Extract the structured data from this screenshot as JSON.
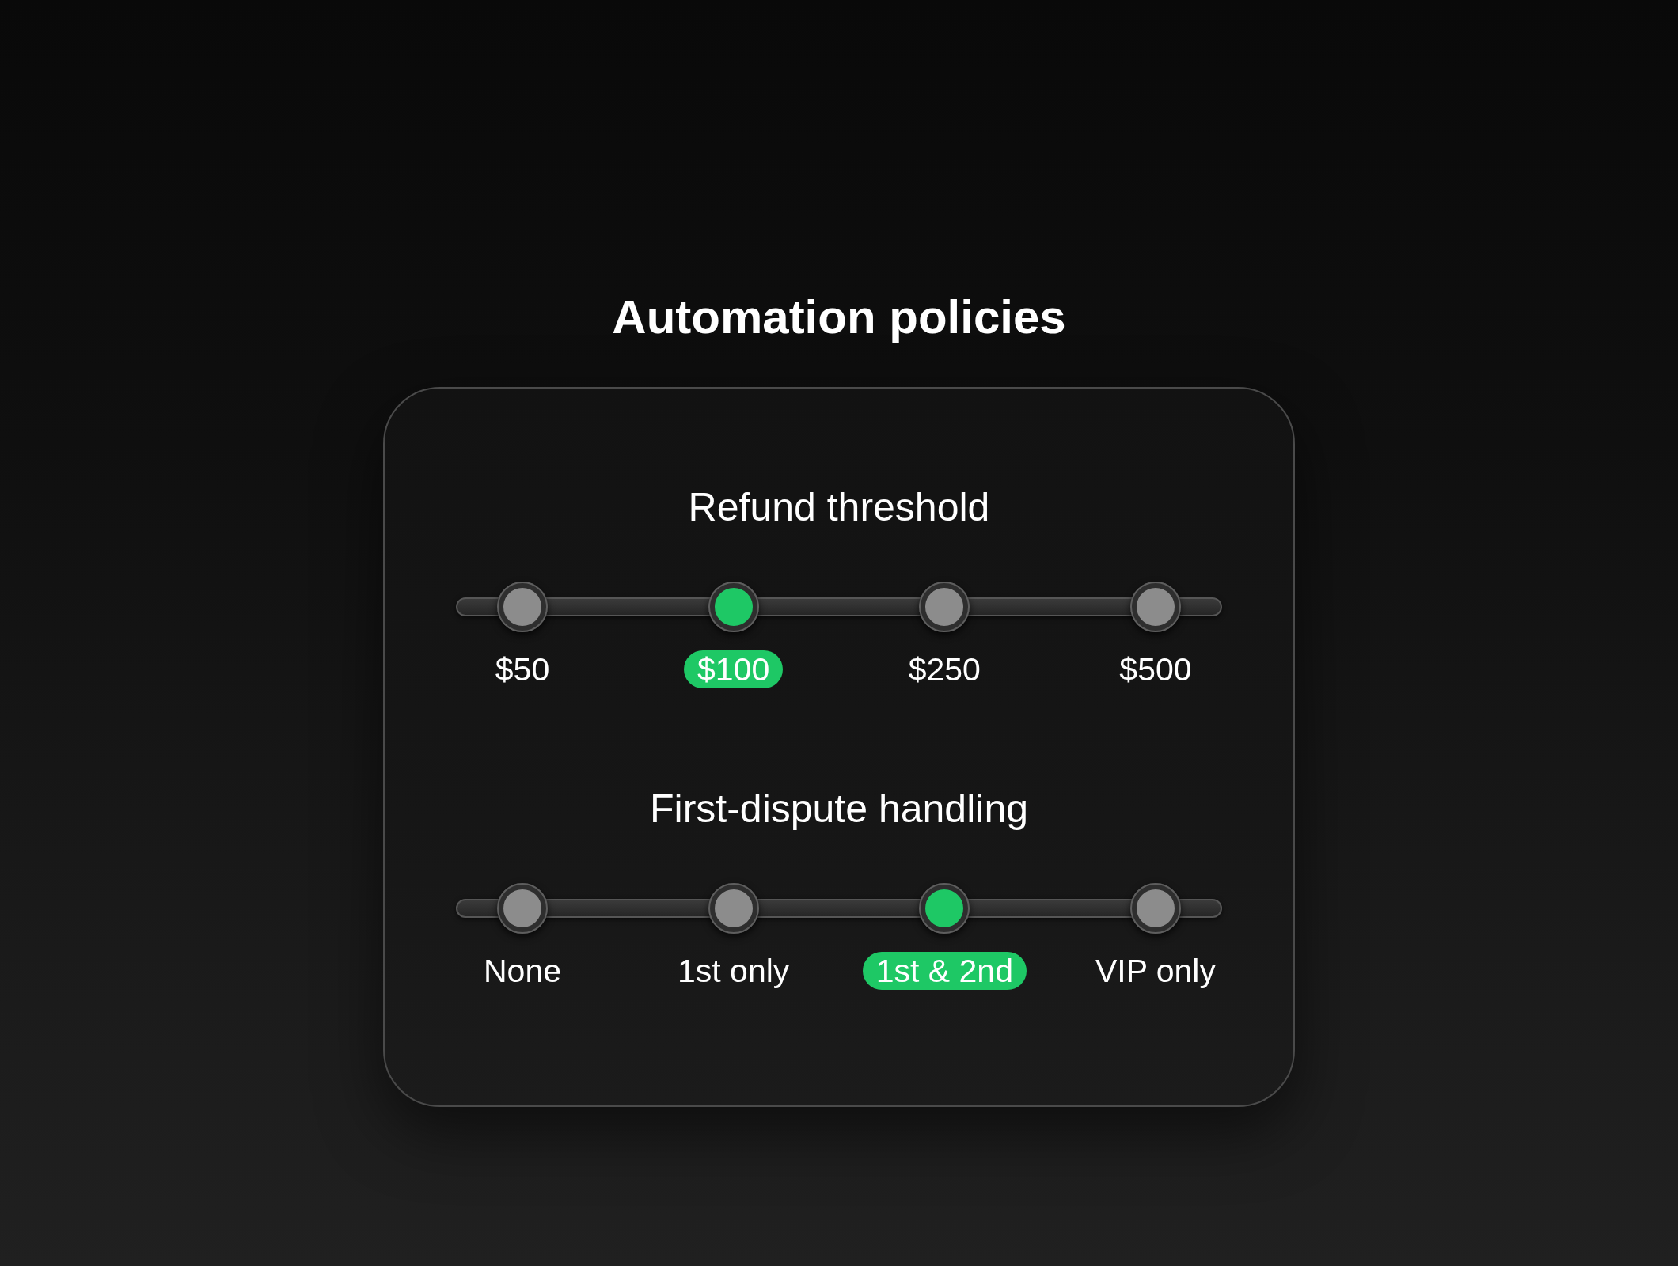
{
  "title": "Automation policies",
  "sliders": [
    {
      "title": "Refund threshold",
      "options": [
        {
          "label": "$50",
          "selected": false
        },
        {
          "label": "$100",
          "selected": true
        },
        {
          "label": "$250",
          "selected": false
        },
        {
          "label": "$500",
          "selected": false
        }
      ]
    },
    {
      "title": "First-dispute handling",
      "options": [
        {
          "label": "None",
          "selected": false
        },
        {
          "label": "1st only",
          "selected": false
        },
        {
          "label": "1st & 2nd",
          "selected": true
        },
        {
          "label": "VIP only",
          "selected": false
        }
      ]
    }
  ]
}
